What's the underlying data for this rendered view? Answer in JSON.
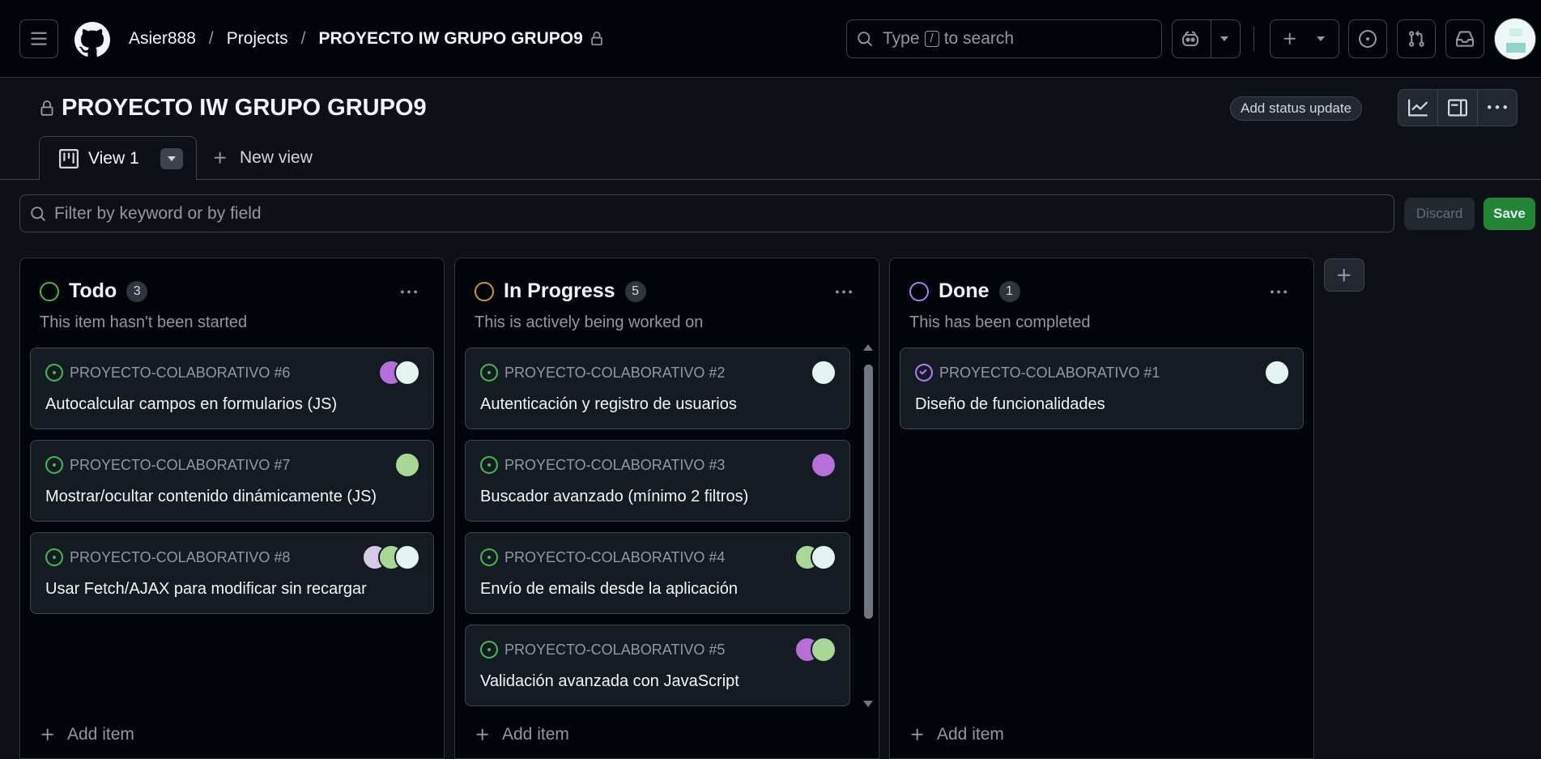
{
  "header": {
    "owner": "Asier888",
    "projects": "Projects",
    "project": "PROYECTO IW GRUPO GRUPO9",
    "search_prefix": "Type",
    "search_key": "/",
    "search_suffix": "to search"
  },
  "project": {
    "title": "PROYECTO IW GRUPO GRUPO9",
    "status_update": "Add status update"
  },
  "tabs": {
    "active": "View 1",
    "new_view": "New view"
  },
  "filter": {
    "placeholder": "Filter by keyword or by field",
    "discard": "Discard",
    "save": "Save"
  },
  "columns": [
    {
      "name": "Todo",
      "count": "3",
      "color": "#3fb950",
      "description": "This item hasn't been started",
      "add_item": "Add item",
      "cards": [
        {
          "ref": "PROYECTO-COLABORATIVO #6",
          "title": "Autocalcular campos en formularios (JS)"
        },
        {
          "ref": "PROYECTO-COLABORATIVO #7",
          "title": "Mostrar/ocultar contenido dinámicamente (JS)"
        },
        {
          "ref": "PROYECTO-COLABORATIVO #8",
          "title": "Usar Fetch/AJAX para modificar sin recargar"
        }
      ]
    },
    {
      "name": "In Progress",
      "count": "5",
      "color": "#d29922",
      "description": "This is actively being worked on",
      "add_item": "Add item",
      "cards": [
        {
          "ref": "PROYECTO-COLABORATIVO #2",
          "title": "Autenticación y registro de usuarios"
        },
        {
          "ref": "PROYECTO-COLABORATIVO #3",
          "title": "Buscador avanzado (mínimo 2 filtros)"
        },
        {
          "ref": "PROYECTO-COLABORATIVO #4",
          "title": "Envío de emails desde la aplicación"
        },
        {
          "ref": "PROYECTO-COLABORATIVO #5",
          "title": "Validación avanzada con JavaScript"
        }
      ]
    },
    {
      "name": "Done",
      "count": "1",
      "color": "#ab7df8",
      "description": "This has been completed",
      "add_item": "Add item",
      "cards": [
        {
          "ref": "PROYECTO-COLABORATIVO #1",
          "title": "Diseño de funcionalidades"
        }
      ]
    }
  ]
}
